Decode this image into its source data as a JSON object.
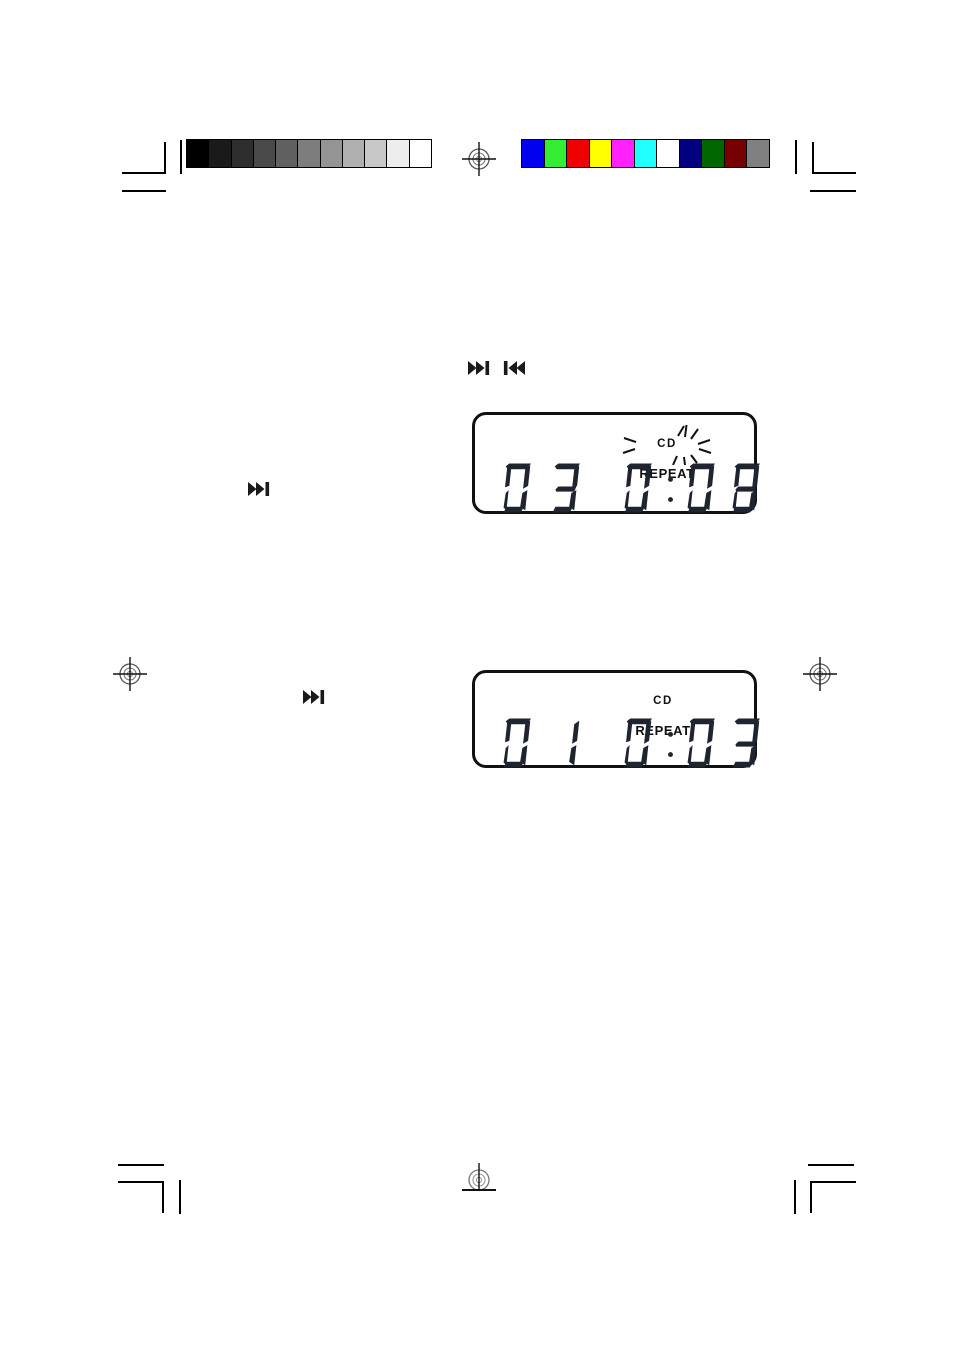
{
  "page": {
    "kind": "scanned-manual-page",
    "background_color": "#ffffff",
    "ink_color": "#111111"
  },
  "calibration": {
    "grayscale_bar": {
      "name": "grayscale-step-wedge",
      "steps": [
        "#000000",
        "#1a1a1a",
        "#2e2e2e",
        "#4a4a4a",
        "#616161",
        "#7d7d7d",
        "#949494",
        "#b0b0b0",
        "#c8c8c8",
        "#ededed",
        "#ffffff"
      ]
    },
    "color_bar": {
      "name": "color-control-patches",
      "steps": [
        "#0000ee",
        "#33ee33",
        "#ee0000",
        "#ffff00",
        "#ff22ff",
        "#22ffff",
        "#ffffff",
        "#000080",
        "#006600",
        "#770000",
        "#808080"
      ]
    }
  },
  "registration_marks": {
    "target_label": "registration-target",
    "corner_label": "crop-mark"
  },
  "icons": {
    "skip_forward": "skip-forward-icon",
    "skip_backward": "skip-backward-icon",
    "row_top": [
      "skip-forward-icon",
      "skip-backward-icon"
    ],
    "mid_left": "skip-forward-icon",
    "lower_left": "skip-forward-icon"
  },
  "displays": [
    {
      "id": "display-repeat-flashing",
      "indicator_line1": "CD",
      "indicator_line2": "REPEAT",
      "flashing": true,
      "track_number": "03",
      "elapsed_time": "0:08",
      "time_digits": [
        "0",
        ":",
        "0",
        "8"
      ],
      "track_digits": [
        "0",
        "3"
      ]
    },
    {
      "id": "display-repeat-steady",
      "indicator_line1": "CD",
      "indicator_line2": "REPEAT",
      "flashing": false,
      "track_number": "01",
      "elapsed_time": "0:03",
      "time_digits": [
        "0",
        ":",
        "0",
        "3"
      ],
      "track_digits": [
        "0",
        "1"
      ]
    }
  ]
}
